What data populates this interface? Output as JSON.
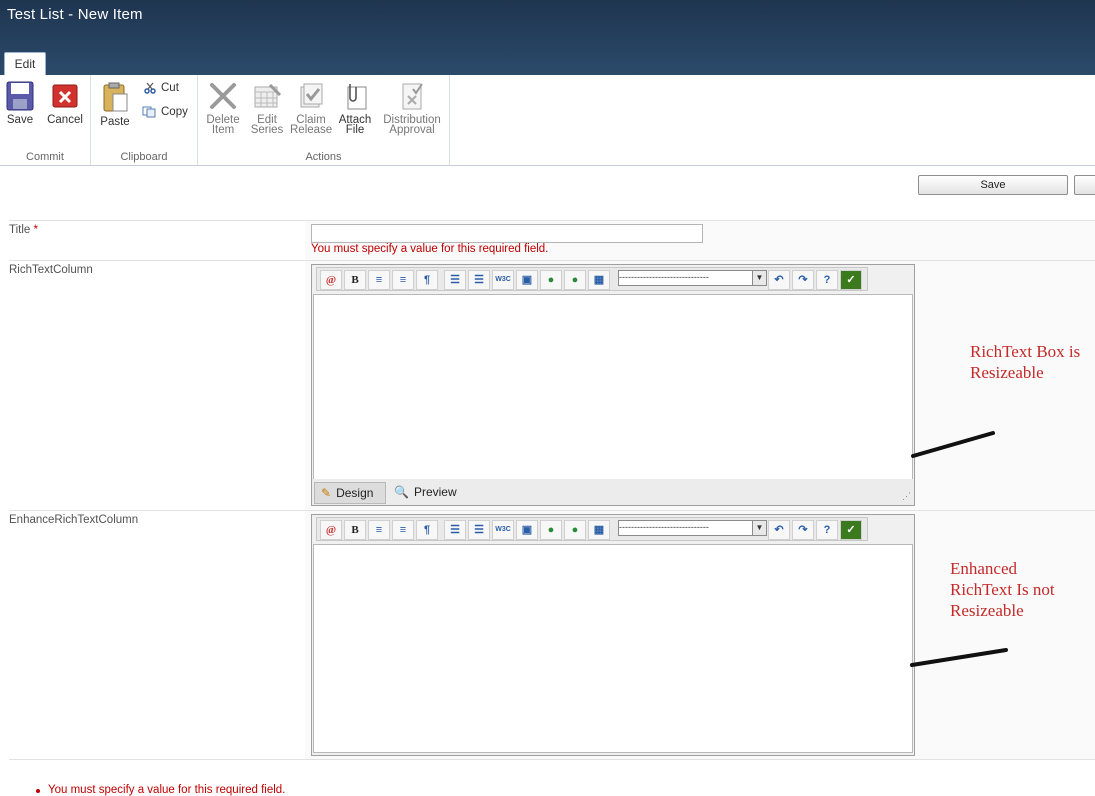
{
  "window": {
    "title": "Test List - New Item"
  },
  "ribbon": {
    "tab_label": "Edit",
    "groups": {
      "commit": {
        "label": "Commit",
        "save": "Save",
        "cancel": "Cancel"
      },
      "clipboard": {
        "label": "Clipboard",
        "paste": "Paste",
        "cut": "Cut",
        "copy": "Copy"
      },
      "actions": {
        "label": "Actions",
        "delete_line1": "Delete",
        "delete_line2": "Item",
        "edit_line1": "Edit",
        "edit_line2": "Series",
        "claim_line1": "Claim",
        "claim_line2": "Release",
        "attach_line1": "Attach",
        "attach_line2": "File",
        "distribution_line1": "Distribution",
        "distribution_line2": "Approval"
      }
    }
  },
  "form": {
    "save_button": "Save",
    "title_label": "Title",
    "required_marker": "*",
    "title_value": "",
    "title_error": "You must specify a value for this required field.",
    "rich_text_label": "RichTextColumn",
    "enhanced_rich_text_label": "EnhanceRichTextColumn",
    "editor": {
      "bold": "B",
      "w3c": "W3C",
      "format_select": "------------------------------",
      "design_tab": "Design",
      "preview_tab": "Preview"
    },
    "summary_error": "You must specify a value for this required field."
  },
  "annotations": {
    "resizeable_line1": "RichText Box is",
    "resizeable_line2": "Resizeable",
    "not_resizeable_line1": "Enhanced",
    "not_resizeable_line2": "RichText Is not",
    "not_resizeable_line3": "Resizeable"
  },
  "colors": {
    "titlebar": "#243d5b",
    "error": "#bf0000",
    "annotation": "#c42a2a"
  }
}
